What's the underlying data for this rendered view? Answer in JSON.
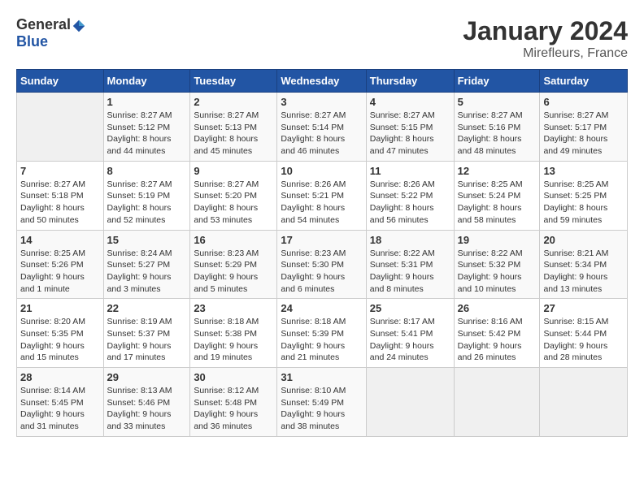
{
  "header": {
    "logo_general": "General",
    "logo_blue": "Blue",
    "month_year": "January 2024",
    "location": "Mirefleurs, France"
  },
  "days_of_week": [
    "Sunday",
    "Monday",
    "Tuesday",
    "Wednesday",
    "Thursday",
    "Friday",
    "Saturday"
  ],
  "weeks": [
    [
      {
        "day": "",
        "sunrise": "",
        "sunset": "",
        "daylight": ""
      },
      {
        "day": "1",
        "sunrise": "Sunrise: 8:27 AM",
        "sunset": "Sunset: 5:12 PM",
        "daylight": "Daylight: 8 hours and 44 minutes."
      },
      {
        "day": "2",
        "sunrise": "Sunrise: 8:27 AM",
        "sunset": "Sunset: 5:13 PM",
        "daylight": "Daylight: 8 hours and 45 minutes."
      },
      {
        "day": "3",
        "sunrise": "Sunrise: 8:27 AM",
        "sunset": "Sunset: 5:14 PM",
        "daylight": "Daylight: 8 hours and 46 minutes."
      },
      {
        "day": "4",
        "sunrise": "Sunrise: 8:27 AM",
        "sunset": "Sunset: 5:15 PM",
        "daylight": "Daylight: 8 hours and 47 minutes."
      },
      {
        "day": "5",
        "sunrise": "Sunrise: 8:27 AM",
        "sunset": "Sunset: 5:16 PM",
        "daylight": "Daylight: 8 hours and 48 minutes."
      },
      {
        "day": "6",
        "sunrise": "Sunrise: 8:27 AM",
        "sunset": "Sunset: 5:17 PM",
        "daylight": "Daylight: 8 hours and 49 minutes."
      }
    ],
    [
      {
        "day": "7",
        "sunrise": "Sunrise: 8:27 AM",
        "sunset": "Sunset: 5:18 PM",
        "daylight": "Daylight: 8 hours and 50 minutes."
      },
      {
        "day": "8",
        "sunrise": "Sunrise: 8:27 AM",
        "sunset": "Sunset: 5:19 PM",
        "daylight": "Daylight: 8 hours and 52 minutes."
      },
      {
        "day": "9",
        "sunrise": "Sunrise: 8:27 AM",
        "sunset": "Sunset: 5:20 PM",
        "daylight": "Daylight: 8 hours and 53 minutes."
      },
      {
        "day": "10",
        "sunrise": "Sunrise: 8:26 AM",
        "sunset": "Sunset: 5:21 PM",
        "daylight": "Daylight: 8 hours and 54 minutes."
      },
      {
        "day": "11",
        "sunrise": "Sunrise: 8:26 AM",
        "sunset": "Sunset: 5:22 PM",
        "daylight": "Daylight: 8 hours and 56 minutes."
      },
      {
        "day": "12",
        "sunrise": "Sunrise: 8:25 AM",
        "sunset": "Sunset: 5:24 PM",
        "daylight": "Daylight: 8 hours and 58 minutes."
      },
      {
        "day": "13",
        "sunrise": "Sunrise: 8:25 AM",
        "sunset": "Sunset: 5:25 PM",
        "daylight": "Daylight: 8 hours and 59 minutes."
      }
    ],
    [
      {
        "day": "14",
        "sunrise": "Sunrise: 8:25 AM",
        "sunset": "Sunset: 5:26 PM",
        "daylight": "Daylight: 9 hours and 1 minute."
      },
      {
        "day": "15",
        "sunrise": "Sunrise: 8:24 AM",
        "sunset": "Sunset: 5:27 PM",
        "daylight": "Daylight: 9 hours and 3 minutes."
      },
      {
        "day": "16",
        "sunrise": "Sunrise: 8:23 AM",
        "sunset": "Sunset: 5:29 PM",
        "daylight": "Daylight: 9 hours and 5 minutes."
      },
      {
        "day": "17",
        "sunrise": "Sunrise: 8:23 AM",
        "sunset": "Sunset: 5:30 PM",
        "daylight": "Daylight: 9 hours and 6 minutes."
      },
      {
        "day": "18",
        "sunrise": "Sunrise: 8:22 AM",
        "sunset": "Sunset: 5:31 PM",
        "daylight": "Daylight: 9 hours and 8 minutes."
      },
      {
        "day": "19",
        "sunrise": "Sunrise: 8:22 AM",
        "sunset": "Sunset: 5:32 PM",
        "daylight": "Daylight: 9 hours and 10 minutes."
      },
      {
        "day": "20",
        "sunrise": "Sunrise: 8:21 AM",
        "sunset": "Sunset: 5:34 PM",
        "daylight": "Daylight: 9 hours and 13 minutes."
      }
    ],
    [
      {
        "day": "21",
        "sunrise": "Sunrise: 8:20 AM",
        "sunset": "Sunset: 5:35 PM",
        "daylight": "Daylight: 9 hours and 15 minutes."
      },
      {
        "day": "22",
        "sunrise": "Sunrise: 8:19 AM",
        "sunset": "Sunset: 5:37 PM",
        "daylight": "Daylight: 9 hours and 17 minutes."
      },
      {
        "day": "23",
        "sunrise": "Sunrise: 8:18 AM",
        "sunset": "Sunset: 5:38 PM",
        "daylight": "Daylight: 9 hours and 19 minutes."
      },
      {
        "day": "24",
        "sunrise": "Sunrise: 8:18 AM",
        "sunset": "Sunset: 5:39 PM",
        "daylight": "Daylight: 9 hours and 21 minutes."
      },
      {
        "day": "25",
        "sunrise": "Sunrise: 8:17 AM",
        "sunset": "Sunset: 5:41 PM",
        "daylight": "Daylight: 9 hours and 24 minutes."
      },
      {
        "day": "26",
        "sunrise": "Sunrise: 8:16 AM",
        "sunset": "Sunset: 5:42 PM",
        "daylight": "Daylight: 9 hours and 26 minutes."
      },
      {
        "day": "27",
        "sunrise": "Sunrise: 8:15 AM",
        "sunset": "Sunset: 5:44 PM",
        "daylight": "Daylight: 9 hours and 28 minutes."
      }
    ],
    [
      {
        "day": "28",
        "sunrise": "Sunrise: 8:14 AM",
        "sunset": "Sunset: 5:45 PM",
        "daylight": "Daylight: 9 hours and 31 minutes."
      },
      {
        "day": "29",
        "sunrise": "Sunrise: 8:13 AM",
        "sunset": "Sunset: 5:46 PM",
        "daylight": "Daylight: 9 hours and 33 minutes."
      },
      {
        "day": "30",
        "sunrise": "Sunrise: 8:12 AM",
        "sunset": "Sunset: 5:48 PM",
        "daylight": "Daylight: 9 hours and 36 minutes."
      },
      {
        "day": "31",
        "sunrise": "Sunrise: 8:10 AM",
        "sunset": "Sunset: 5:49 PM",
        "daylight": "Daylight: 9 hours and 38 minutes."
      },
      {
        "day": "",
        "sunrise": "",
        "sunset": "",
        "daylight": ""
      },
      {
        "day": "",
        "sunrise": "",
        "sunset": "",
        "daylight": ""
      },
      {
        "day": "",
        "sunrise": "",
        "sunset": "",
        "daylight": ""
      }
    ]
  ]
}
